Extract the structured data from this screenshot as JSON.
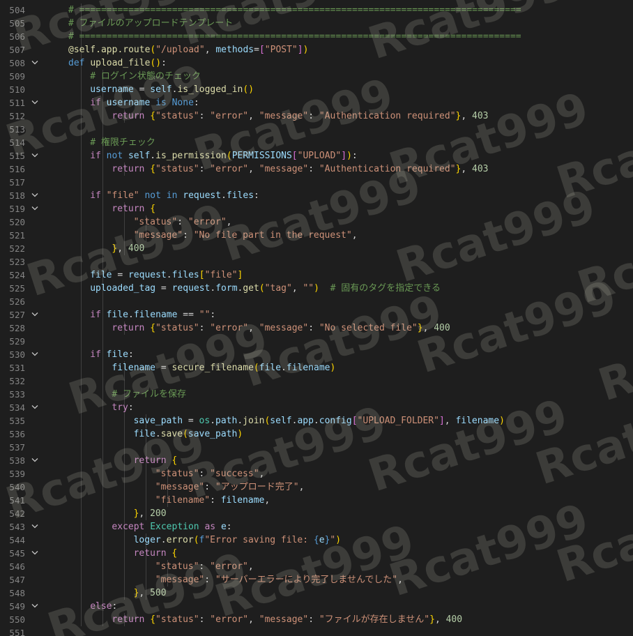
{
  "editor": {
    "gutter": {
      "line_numbers": [
        "504",
        "505",
        "506",
        "507",
        "508",
        "509",
        "510",
        "511",
        "512",
        "513",
        "514",
        "515",
        "516",
        "517",
        "518",
        "519",
        "520",
        "521",
        "522",
        "523",
        "524",
        "525",
        "526",
        "527",
        "528",
        "529",
        "530",
        "531",
        "532",
        "533",
        "534",
        "535",
        "536",
        "537",
        "538",
        "539",
        "540",
        "541",
        "542",
        "543",
        "544",
        "545",
        "546",
        "547",
        "548",
        "549",
        "550",
        "551"
      ],
      "fold_icon": "chevron-down-icon"
    },
    "lines": [
      {
        "indent": 2,
        "tokens": [
          [
            "cmt",
            "# ================================================================================="
          ]
        ]
      },
      {
        "indent": 2,
        "tokens": [
          [
            "cmt",
            "# ファイルのアップロードテンプレート"
          ]
        ]
      },
      {
        "indent": 2,
        "tokens": [
          [
            "cmt",
            "# ================================================================================="
          ]
        ]
      },
      {
        "indent": 2,
        "tokens": [
          [
            "dec",
            "@self.app.route"
          ],
          [
            "br1",
            "("
          ],
          [
            "str",
            "\"/upload\""
          ],
          [
            "punc",
            ", "
          ],
          [
            "var",
            "methods"
          ],
          [
            "punc",
            "="
          ],
          [
            "br2",
            "["
          ],
          [
            "str",
            "\"POST\""
          ],
          [
            "br2",
            "]"
          ],
          [
            "br1",
            ")"
          ]
        ]
      },
      {
        "indent": 2,
        "fold": true,
        "tokens": [
          [
            "kw",
            "def "
          ],
          [
            "fn",
            "upload_file"
          ],
          [
            "br1",
            "("
          ],
          [
            "br1",
            ")"
          ],
          [
            "punc",
            ":"
          ]
        ]
      },
      {
        "indent": 3,
        "tokens": [
          [
            "cmt",
            "# ログイン状態のチェック"
          ]
        ]
      },
      {
        "indent": 3,
        "tokens": [
          [
            "var",
            "username"
          ],
          [
            "punc",
            " = "
          ],
          [
            "self",
            "self"
          ],
          [
            "punc",
            "."
          ],
          [
            "fn",
            "is_logged_in"
          ],
          [
            "br1",
            "("
          ],
          [
            "br1",
            ")"
          ]
        ]
      },
      {
        "indent": 3,
        "fold": true,
        "tokens": [
          [
            "ctrl",
            "if "
          ],
          [
            "var",
            "username"
          ],
          [
            "kw",
            " is "
          ],
          [
            "kw",
            "None"
          ],
          [
            "punc",
            ":"
          ]
        ]
      },
      {
        "indent": 4,
        "tokens": [
          [
            "ctrl",
            "return "
          ],
          [
            "br1",
            "{"
          ],
          [
            "str",
            "\"status\""
          ],
          [
            "punc",
            ": "
          ],
          [
            "str",
            "\"error\""
          ],
          [
            "punc",
            ", "
          ],
          [
            "str",
            "\"message\""
          ],
          [
            "punc",
            ": "
          ],
          [
            "str",
            "\"Authentication required\""
          ],
          [
            "br1",
            "}"
          ],
          [
            "punc",
            ", "
          ],
          [
            "num",
            "403"
          ]
        ]
      },
      {
        "indent": 0,
        "tokens": []
      },
      {
        "indent": 3,
        "tokens": [
          [
            "cmt",
            "# 権限チェック"
          ]
        ]
      },
      {
        "indent": 3,
        "fold": true,
        "tokens": [
          [
            "ctrl",
            "if "
          ],
          [
            "kw",
            "not "
          ],
          [
            "self",
            "self"
          ],
          [
            "punc",
            "."
          ],
          [
            "fn",
            "is_permission"
          ],
          [
            "br1",
            "("
          ],
          [
            "var",
            "PERMISSIONS"
          ],
          [
            "br2",
            "["
          ],
          [
            "str",
            "\"UPLOAD\""
          ],
          [
            "br2",
            "]"
          ],
          [
            "br1",
            ")"
          ],
          [
            "punc",
            ":"
          ]
        ]
      },
      {
        "indent": 4,
        "tokens": [
          [
            "ctrl",
            "return "
          ],
          [
            "br1",
            "{"
          ],
          [
            "str",
            "\"status\""
          ],
          [
            "punc",
            ": "
          ],
          [
            "str",
            "\"error\""
          ],
          [
            "punc",
            ", "
          ],
          [
            "str",
            "\"message\""
          ],
          [
            "punc",
            ": "
          ],
          [
            "str",
            "\"Authentication required\""
          ],
          [
            "br1",
            "}"
          ],
          [
            "punc",
            ", "
          ],
          [
            "num",
            "403"
          ]
        ]
      },
      {
        "indent": 0,
        "tokens": []
      },
      {
        "indent": 3,
        "fold": true,
        "tokens": [
          [
            "ctrl",
            "if "
          ],
          [
            "str",
            "\"file\""
          ],
          [
            "kw",
            " not in "
          ],
          [
            "var",
            "request"
          ],
          [
            "punc",
            "."
          ],
          [
            "var",
            "files"
          ],
          [
            "punc",
            ":"
          ]
        ]
      },
      {
        "indent": 4,
        "fold": true,
        "tokens": [
          [
            "ctrl",
            "return "
          ],
          [
            "br1",
            "{"
          ]
        ]
      },
      {
        "indent": 5,
        "tokens": [
          [
            "str",
            "\"status\""
          ],
          [
            "punc",
            ": "
          ],
          [
            "str",
            "\"error\""
          ],
          [
            "punc",
            ","
          ]
        ]
      },
      {
        "indent": 5,
        "tokens": [
          [
            "str",
            "\"message\""
          ],
          [
            "punc",
            ": "
          ],
          [
            "str",
            "\"No file part in the request\""
          ],
          [
            "punc",
            ","
          ]
        ]
      },
      {
        "indent": 4,
        "tokens": [
          [
            "br1",
            "}"
          ],
          [
            "punc",
            ", "
          ],
          [
            "num",
            "400"
          ]
        ]
      },
      {
        "indent": 0,
        "tokens": []
      },
      {
        "indent": 3,
        "tokens": [
          [
            "var",
            "file"
          ],
          [
            "punc",
            " = "
          ],
          [
            "var",
            "request"
          ],
          [
            "punc",
            "."
          ],
          [
            "var",
            "files"
          ],
          [
            "br1",
            "["
          ],
          [
            "str",
            "\"file\""
          ],
          [
            "br1",
            "]"
          ]
        ]
      },
      {
        "indent": 3,
        "tokens": [
          [
            "var",
            "uploaded_tag"
          ],
          [
            "punc",
            " = "
          ],
          [
            "var",
            "request"
          ],
          [
            "punc",
            "."
          ],
          [
            "var",
            "form"
          ],
          [
            "punc",
            "."
          ],
          [
            "fn",
            "get"
          ],
          [
            "br1",
            "("
          ],
          [
            "str",
            "\"tag\""
          ],
          [
            "punc",
            ", "
          ],
          [
            "str",
            "\"\""
          ],
          [
            "br1",
            ")"
          ],
          [
            "punc",
            "  "
          ],
          [
            "cmt",
            "# 固有のタグを指定できる"
          ]
        ]
      },
      {
        "indent": 0,
        "tokens": []
      },
      {
        "indent": 3,
        "fold": true,
        "tokens": [
          [
            "ctrl",
            "if "
          ],
          [
            "var",
            "file"
          ],
          [
            "punc",
            "."
          ],
          [
            "var",
            "filename"
          ],
          [
            "punc",
            " == "
          ],
          [
            "str",
            "\"\""
          ],
          [
            "punc",
            ":"
          ]
        ]
      },
      {
        "indent": 4,
        "tokens": [
          [
            "ctrl",
            "return "
          ],
          [
            "br1",
            "{"
          ],
          [
            "str",
            "\"status\""
          ],
          [
            "punc",
            ": "
          ],
          [
            "str",
            "\"error\""
          ],
          [
            "punc",
            ", "
          ],
          [
            "str",
            "\"message\""
          ],
          [
            "punc",
            ": "
          ],
          [
            "str",
            "\"No selected file\""
          ],
          [
            "br1",
            "}"
          ],
          [
            "punc",
            ", "
          ],
          [
            "num",
            "400"
          ]
        ]
      },
      {
        "indent": 0,
        "tokens": []
      },
      {
        "indent": 3,
        "fold": true,
        "tokens": [
          [
            "ctrl",
            "if "
          ],
          [
            "var",
            "file"
          ],
          [
            "punc",
            ":"
          ]
        ]
      },
      {
        "indent": 4,
        "tokens": [
          [
            "var",
            "filename"
          ],
          [
            "punc",
            " = "
          ],
          [
            "fn",
            "secure_filename"
          ],
          [
            "br1",
            "("
          ],
          [
            "var",
            "file"
          ],
          [
            "punc",
            "."
          ],
          [
            "var",
            "filename"
          ],
          [
            "br1",
            ")"
          ]
        ]
      },
      {
        "indent": 0,
        "tokens": []
      },
      {
        "indent": 4,
        "tokens": [
          [
            "cmt",
            "# ファイルを保存"
          ]
        ]
      },
      {
        "indent": 4,
        "fold": true,
        "tokens": [
          [
            "ctrl",
            "try"
          ],
          [
            "punc",
            ":"
          ]
        ]
      },
      {
        "indent": 5,
        "tokens": [
          [
            "var",
            "save_path"
          ],
          [
            "punc",
            " = "
          ],
          [
            "cls",
            "os"
          ],
          [
            "punc",
            "."
          ],
          [
            "var",
            "path"
          ],
          [
            "punc",
            "."
          ],
          [
            "fn",
            "join"
          ],
          [
            "br1",
            "("
          ],
          [
            "self",
            "self"
          ],
          [
            "punc",
            "."
          ],
          [
            "var",
            "app"
          ],
          [
            "punc",
            "."
          ],
          [
            "var",
            "config"
          ],
          [
            "br2",
            "["
          ],
          [
            "str",
            "\"UPLOAD_FOLDER\""
          ],
          [
            "br2",
            "]"
          ],
          [
            "punc",
            ", "
          ],
          [
            "var",
            "filename"
          ],
          [
            "br1",
            ")"
          ]
        ]
      },
      {
        "indent": 5,
        "tokens": [
          [
            "var",
            "file"
          ],
          [
            "punc",
            "."
          ],
          [
            "fn",
            "save"
          ],
          [
            "br1",
            "("
          ],
          [
            "var",
            "save_path"
          ],
          [
            "br1",
            ")"
          ]
        ]
      },
      {
        "indent": 0,
        "tokens": []
      },
      {
        "indent": 5,
        "fold": true,
        "tokens": [
          [
            "ctrl",
            "return "
          ],
          [
            "br1",
            "{"
          ]
        ]
      },
      {
        "indent": 6,
        "tokens": [
          [
            "str",
            "\"status\""
          ],
          [
            "punc",
            ": "
          ],
          [
            "str",
            "\"success\""
          ],
          [
            "punc",
            ","
          ]
        ]
      },
      {
        "indent": 6,
        "tokens": [
          [
            "str",
            "\"message\""
          ],
          [
            "punc",
            ": "
          ],
          [
            "str",
            "\"アップロード完了\""
          ],
          [
            "punc",
            ","
          ]
        ]
      },
      {
        "indent": 6,
        "tokens": [
          [
            "str",
            "\"filename\""
          ],
          [
            "punc",
            ": "
          ],
          [
            "var",
            "filename"
          ],
          [
            "punc",
            ","
          ]
        ]
      },
      {
        "indent": 5,
        "tokens": [
          [
            "br1",
            "}"
          ],
          [
            "punc",
            ", "
          ],
          [
            "num",
            "200"
          ]
        ]
      },
      {
        "indent": 4,
        "fold": true,
        "tokens": [
          [
            "ctrl",
            "except "
          ],
          [
            "cls",
            "Exception"
          ],
          [
            "ctrl",
            " as "
          ],
          [
            "var",
            "e"
          ],
          [
            "punc",
            ":"
          ]
        ]
      },
      {
        "indent": 5,
        "tokens": [
          [
            "var",
            "loger"
          ],
          [
            "punc",
            "."
          ],
          [
            "fn",
            "error"
          ],
          [
            "br1",
            "("
          ],
          [
            "kw",
            "f"
          ],
          [
            "str",
            "\"Error saving file: "
          ],
          [
            "kw",
            "{"
          ],
          [
            "var",
            "e"
          ],
          [
            "kw",
            "}"
          ],
          [
            "str",
            "\""
          ],
          [
            "br1",
            ")"
          ]
        ]
      },
      {
        "indent": 5,
        "fold": true,
        "tokens": [
          [
            "ctrl",
            "return "
          ],
          [
            "br1",
            "{"
          ]
        ]
      },
      {
        "indent": 6,
        "tokens": [
          [
            "str",
            "\"status\""
          ],
          [
            "punc",
            ": "
          ],
          [
            "str",
            "\"error\""
          ],
          [
            "punc",
            ","
          ]
        ]
      },
      {
        "indent": 6,
        "tokens": [
          [
            "str",
            "\"message\""
          ],
          [
            "punc",
            ": "
          ],
          [
            "str",
            "\"サーバーエラーにより完了しませんでした\""
          ],
          [
            "punc",
            ","
          ]
        ]
      },
      {
        "indent": 5,
        "tokens": [
          [
            "br1",
            "}"
          ],
          [
            "punc",
            ", "
          ],
          [
            "num",
            "500"
          ]
        ]
      },
      {
        "indent": 3,
        "fold": true,
        "tokens": [
          [
            "ctrl",
            "else"
          ],
          [
            "punc",
            ":"
          ]
        ]
      },
      {
        "indent": 4,
        "tokens": [
          [
            "ctrl",
            "return "
          ],
          [
            "br1",
            "{"
          ],
          [
            "str",
            "\"status\""
          ],
          [
            "punc",
            ": "
          ],
          [
            "str",
            "\"error\""
          ],
          [
            "punc",
            ", "
          ],
          [
            "str",
            "\"message\""
          ],
          [
            "punc",
            ": "
          ],
          [
            "str",
            "\"ファイルが存在しません\""
          ],
          [
            "br1",
            "}"
          ],
          [
            "punc",
            ", "
          ],
          [
            "num",
            "400"
          ]
        ]
      },
      {
        "indent": 0,
        "tokens": []
      }
    ]
  },
  "watermark": {
    "text": "Rcat999"
  },
  "colors": {
    "background": "#1e1e1e",
    "line_number": "#858585",
    "comment": "#6a9955",
    "string": "#ce9178",
    "keyword": "#569cd6",
    "control": "#c586c0",
    "function": "#dcdcaa",
    "variable": "#9cdcfe",
    "number": "#b5cea8"
  }
}
